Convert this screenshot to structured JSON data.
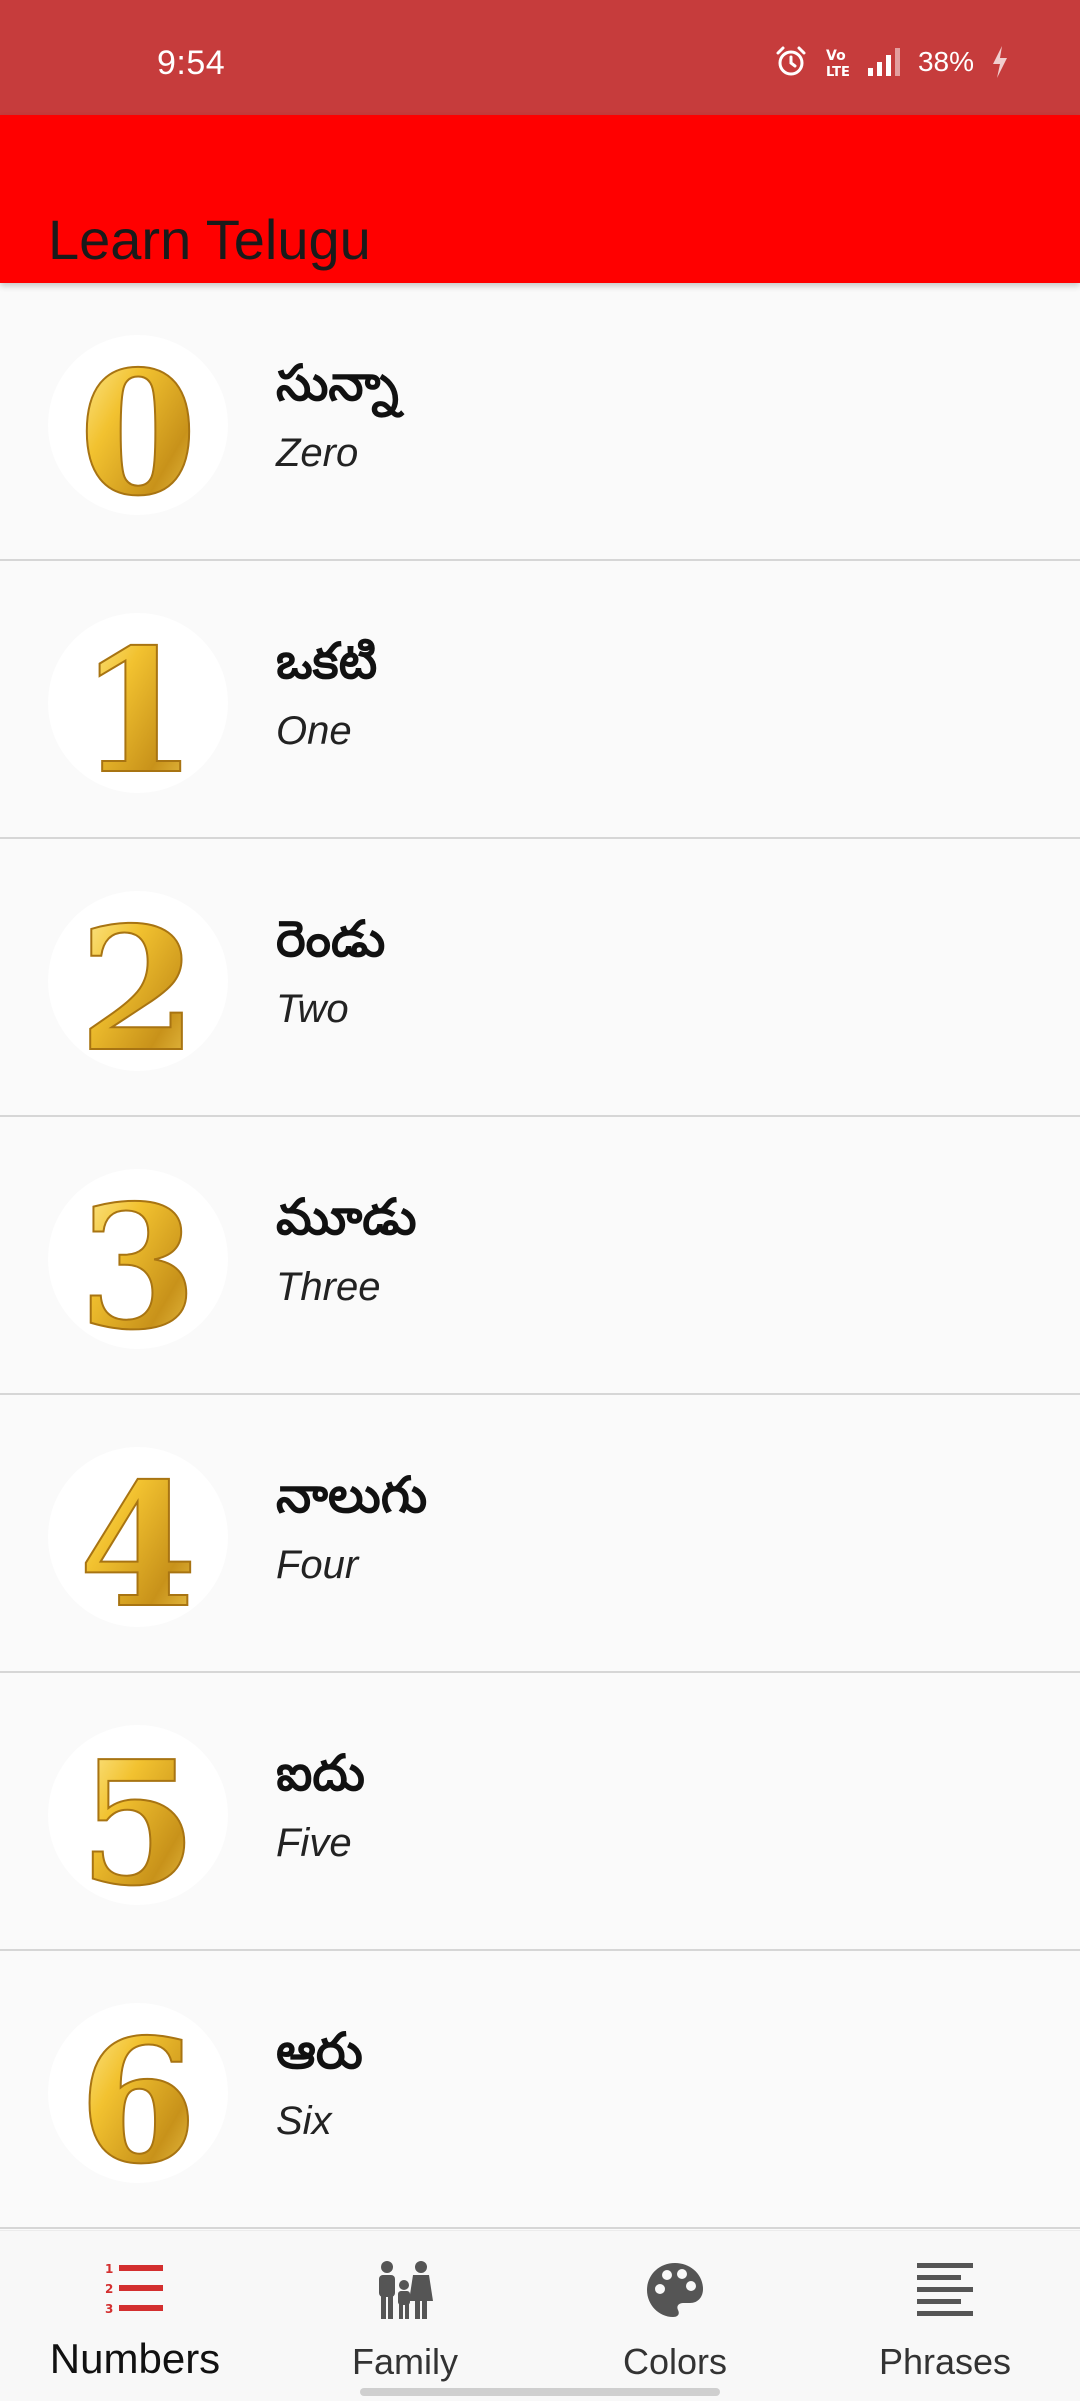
{
  "status_bar": {
    "time": "9:54",
    "battery": "38%",
    "icons": [
      "alarm-icon",
      "volte-icon",
      "signal-icon",
      "charging-icon"
    ],
    "bg_color": "#c63c3c"
  },
  "app_bar": {
    "title": "Learn Telugu",
    "bg_color": "#ff0000"
  },
  "numbers": [
    {
      "digit": "0",
      "telugu": "సున్నా",
      "english": "Zero"
    },
    {
      "digit": "1",
      "telugu": "ఒకటి",
      "english": "One"
    },
    {
      "digit": "2",
      "telugu": "రెండు",
      "english": "Two"
    },
    {
      "digit": "3",
      "telugu": "మూడు",
      "english": "Three"
    },
    {
      "digit": "4",
      "telugu": "నాలుగు",
      "english": "Four"
    },
    {
      "digit": "5",
      "telugu": "ఐదు",
      "english": "Five"
    },
    {
      "digit": "6",
      "telugu": "ఆరు",
      "english": "Six"
    }
  ],
  "bottom_nav": {
    "items": [
      {
        "label": "Numbers",
        "icon": "numbered-list-icon",
        "active": true
      },
      {
        "label": "Family",
        "icon": "family-icon",
        "active": false
      },
      {
        "label": "Colors",
        "icon": "palette-icon",
        "active": false
      },
      {
        "label": "Phrases",
        "icon": "text-lines-icon",
        "active": false
      }
    ],
    "active_color": "#d32f2f",
    "inactive_color": "#555555"
  }
}
